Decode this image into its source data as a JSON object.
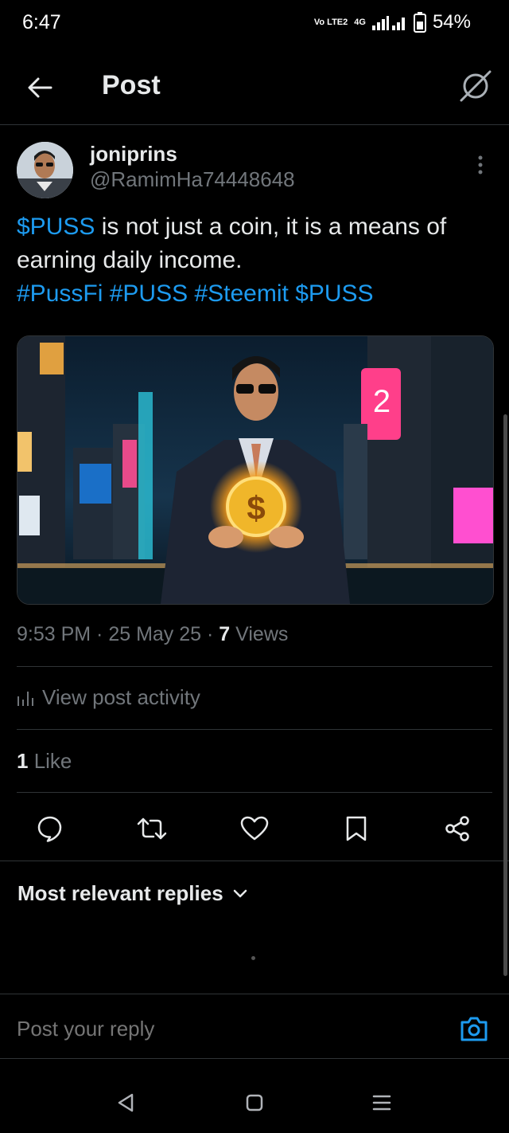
{
  "status_bar": {
    "time": "6:47",
    "network": "Vo LTE2",
    "net_gen": "4G",
    "battery": "54%"
  },
  "header": {
    "title": "Post"
  },
  "author": {
    "name": "joniprins",
    "handle": "@RamimHa74448648"
  },
  "post": {
    "segments": [
      {
        "text": "$PUSS",
        "link": true
      },
      {
        "text": " is not just a coin, it is a means of earning daily income.",
        "link": false
      }
    ],
    "tags": [
      "#PussFi",
      "#PUSS",
      "#Steemit",
      "$PUSS"
    ],
    "image_alt": "man-holding-glowing-dollar-coin"
  },
  "meta": {
    "time": "9:53 PM",
    "sep": " · ",
    "date": "25 May 25",
    "views_count": "7",
    "views_label": " Views"
  },
  "activity": {
    "label": "View post activity"
  },
  "likes": {
    "count": "1",
    "label": " Like"
  },
  "replies": {
    "sort_label": "Most relevant replies"
  },
  "reply_box": {
    "placeholder": "Post your reply"
  },
  "colors": {
    "accent": "#1d9bf0",
    "background": "#000000",
    "muted": "#71767b",
    "divider": "#2f3336"
  }
}
